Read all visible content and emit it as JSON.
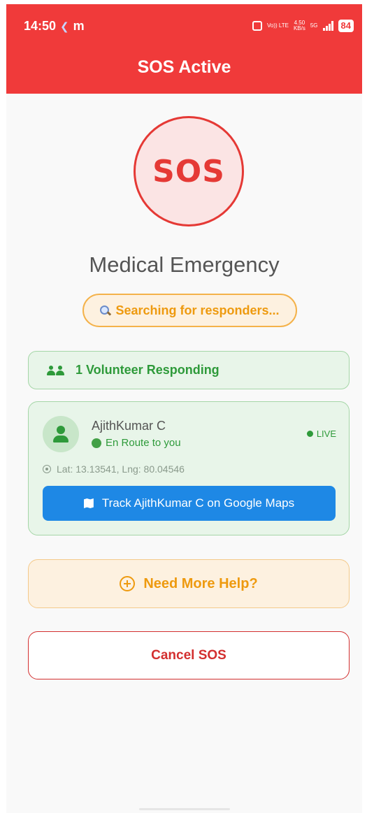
{
  "status_bar": {
    "time": "14:50",
    "app_icon_letter": "m",
    "volte_label": "Vo)) LTE",
    "speed_value": "4.50",
    "speed_unit": "KB/s",
    "network": "5G",
    "battery": "84"
  },
  "header": {
    "title": "SOS Active",
    "background_color": "#f03a3a"
  },
  "sos_badge": {
    "label": "SOS",
    "color": "#e53935"
  },
  "emergency": {
    "type": "Medical Emergency"
  },
  "search_status": {
    "label": "Searching for responders...",
    "icon": "magnifier-icon"
  },
  "volunteers": {
    "label": "1 Volunteer Responding",
    "icon": "people-icon"
  },
  "responder": {
    "name": "AjithKumar C",
    "status": "En Route to you",
    "live_label": "LIVE",
    "coordinates": "Lat: 13.13541, Lng: 80.04546",
    "track_button_label": "Track AjithKumar C on Google Maps"
  },
  "actions": {
    "help_label": "Need More Help?",
    "cancel_label": "Cancel SOS"
  },
  "colors": {
    "green": "#2e9a3a",
    "orange": "#ee9a0f",
    "blue": "#1e88e5",
    "red": "#d32f2f"
  }
}
